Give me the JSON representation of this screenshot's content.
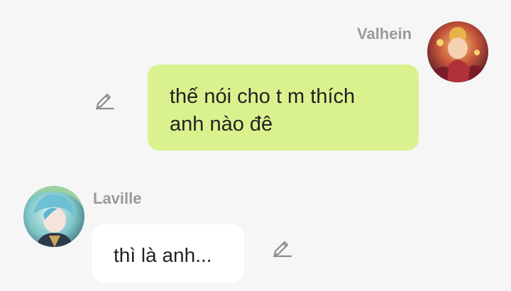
{
  "messages": [
    {
      "sender": "Valhein",
      "direction": "outgoing",
      "lines": [
        "thế nói cho t m thích",
        "anh nào đê"
      ],
      "avatar_icon": "valhein-avatar",
      "action_icon": "edit-icon"
    },
    {
      "sender": "Laville",
      "direction": "incoming",
      "text": "thì là anh...",
      "avatar_icon": "laville-avatar",
      "action_icon": "edit-icon"
    }
  ],
  "colors": {
    "background": "#f6f6f6",
    "outgoing_bubble": "#d9f28e",
    "incoming_bubble": "#ffffff",
    "sender_name": "#9a9a9a",
    "icon": "#8c8c8c"
  }
}
